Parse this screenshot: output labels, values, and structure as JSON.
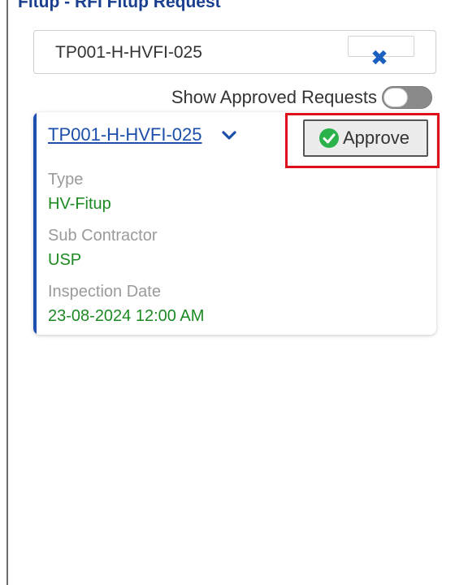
{
  "header": {
    "title_main": "Fitup",
    "title_sep": " - ",
    "title_sub": "RFI Fitup Request"
  },
  "search": {
    "value": "TP001-H-HVFI-025",
    "clear_icon": "close-icon"
  },
  "filters": {
    "show_approved_label": "Show Approved Requests",
    "show_approved_on": false
  },
  "card": {
    "request_id": "TP001-H-HVFI-025",
    "expand_icon": "chevron-down-icon",
    "approve_label": "Approve",
    "approve_icon": "check-circle-icon",
    "fields": [
      {
        "label": "Type",
        "value": "HV-Fitup"
      },
      {
        "label": "Sub Contractor",
        "value": "USP"
      },
      {
        "label": "Inspection Date",
        "value": "23-08-2024 12:00 AM"
      }
    ]
  },
  "colors": {
    "accent": "#1f4fb0",
    "link": "#1d4faa",
    "value_green": "#1c8a22",
    "highlight_red": "#e0101a",
    "approve_check": "#2bb24a"
  }
}
